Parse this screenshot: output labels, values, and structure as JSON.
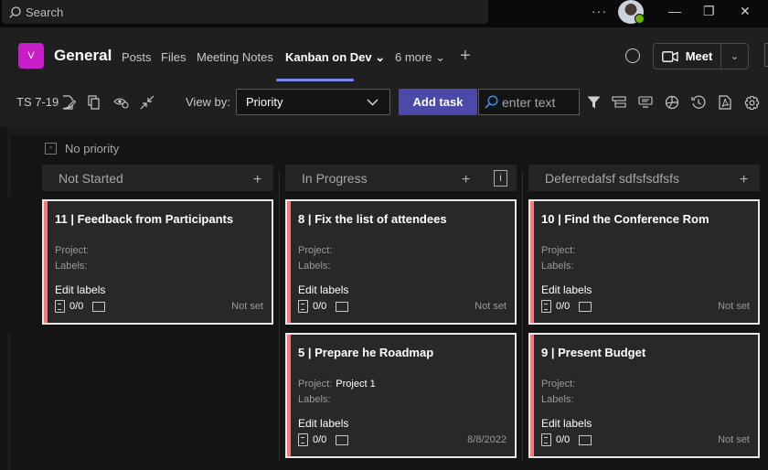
{
  "titlebar": {
    "search_placeholder": "Search",
    "more": "···",
    "minimize": "—",
    "maximize": "❐",
    "close": "✕"
  },
  "channel": {
    "team_initial": "V",
    "name": "General",
    "tabs": [
      {
        "label": "Posts",
        "active": false
      },
      {
        "label": "Files",
        "active": false
      },
      {
        "label": "Meeting Notes",
        "active": false
      },
      {
        "label": "Kanban on Dev ⌄",
        "active": true
      },
      {
        "label": "6 more ⌄",
        "active": false
      }
    ],
    "add_tab": "+",
    "meet_label": "Meet",
    "meet_dropdown": "⌄"
  },
  "toolbar": {
    "board_name": "TS 7-19",
    "view_by_label": "View by:",
    "view_by_value": "Priority",
    "add_task_label": "Add task",
    "filter_placeholder": "enter text"
  },
  "board": {
    "swimlane": {
      "toggle": "-",
      "label": "No priority"
    },
    "columns": [
      {
        "title": "Not Started",
        "add": "+"
      },
      {
        "title": "In Progress",
        "add": "+",
        "info": "i"
      },
      {
        "title": "Deferredafsf sdfsfsdfsfs",
        "add": "+"
      }
    ],
    "cards": [
      {
        "title": "11 | Feedback from Participants",
        "project_label": "Project:",
        "project": "",
        "labels_label": "Labels:",
        "edit_labels": "Edit labels",
        "checklist": "0/0",
        "due": "Not set"
      },
      {
        "title": "8 | Fix the list of attendees",
        "project_label": "Project:",
        "project": "",
        "labels_label": "Labels:",
        "edit_labels": "Edit labels",
        "checklist": "0/0",
        "due": "Not set"
      },
      {
        "title": "10 | Find the Conference Rom",
        "project_label": "Project:",
        "project": "",
        "labels_label": "Labels:",
        "edit_labels": "Edit labels",
        "checklist": "0/0",
        "due": "Not set"
      },
      {
        "title": "5 | Prepare he Roadmap",
        "project_label": "Project:",
        "project": "Project 1",
        "labels_label": "Labels:",
        "edit_labels": "Edit labels",
        "checklist": "0/0",
        "due": "8/8/2022"
      },
      {
        "title": "9 | Present Budget",
        "project_label": "Project:",
        "project": "",
        "labels_label": "Labels:",
        "edit_labels": "Edit labels",
        "checklist": "0/0",
        "due": "Not set"
      }
    ]
  },
  "colors": {
    "accent": "#7f85f5",
    "add_task": "#4b4aa8",
    "team_avatar": "#c81ec8",
    "priority_bar": "#f27b7b",
    "presence": "#6bb700"
  }
}
